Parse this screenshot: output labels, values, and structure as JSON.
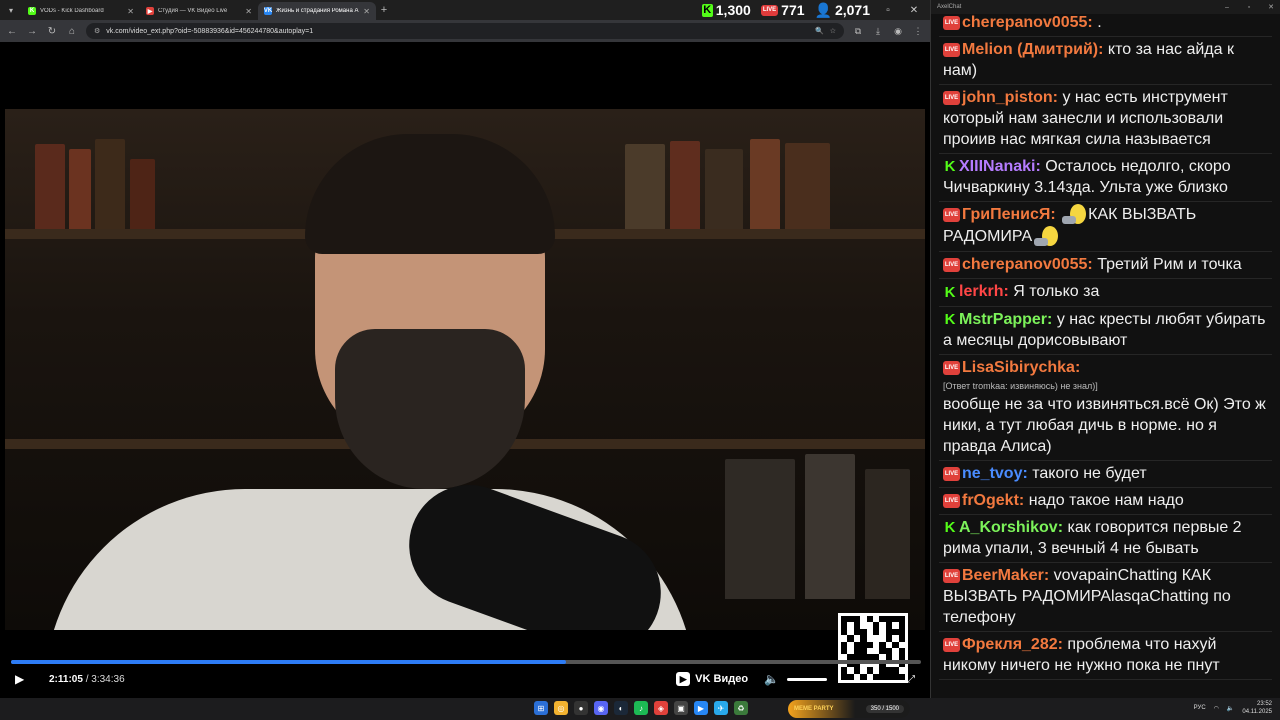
{
  "browser": {
    "tabs": [
      {
        "title": "VODs - Kick Dashboard",
        "fav_color": "#53fc18",
        "fav_letter": "K",
        "active": false
      },
      {
        "title": "Студия — VK Видео Live",
        "fav_color": "#e0413b",
        "fav_letter": "▶",
        "active": false
      },
      {
        "title": "Жизнь и страдания Романа А",
        "fav_color": "#2787f5",
        "fav_letter": "VK",
        "active": true
      }
    ],
    "url": "vk.com/video_ext.php?oid=-50883936&id=456244780&autoplay=1"
  },
  "stats": {
    "kick_count": "1,300",
    "live_count": "771",
    "viewers": "2,071",
    "live_badge": "LIVE"
  },
  "video": {
    "current_time": "2:11:05",
    "separator": "/",
    "duration": "3:34:36",
    "progress": 0.61,
    "brand": "VK Видео"
  },
  "chat": {
    "window_title": "AxelChat",
    "messages": [
      {
        "platform": "live",
        "user": "cherepanov0055:",
        "color": "#f2793f",
        "text": "."
      },
      {
        "platform": "live",
        "user": "Melion (Дмитрий):",
        "color": "#f2793f",
        "text": "кто за нас айда к нам)"
      },
      {
        "platform": "live",
        "user": "john_piston:",
        "color": "#f2793f",
        "text": "у нас есть инструмент который нам занесли и использовали проиив нас мягкая сила называется"
      },
      {
        "platform": "kick",
        "user": "XIIINanaki:",
        "color": "#b57cff",
        "text": "Осталось недолго, скоро Чичваркину 3.14зда. Ульта уже близко"
      },
      {
        "platform": "live",
        "user": "ГриПенисЯ:",
        "color": "#f2793f",
        "text_a": "КАК ВЫЗВАТЬ",
        "text_b": "РАДОМИРА",
        "emote": true
      },
      {
        "platform": "live",
        "user": "cherepanov0055:",
        "color": "#f2793f",
        "text": "Третий Рим и точка"
      },
      {
        "platform": "kick",
        "user": "lerkrh:",
        "color": "#ff4646",
        "text": "Я только за"
      },
      {
        "platform": "kick",
        "user": "MstrPapper:",
        "color": "#7cf25a",
        "text": "у нас кресты любят убирать а месяцы дорисовывают"
      },
      {
        "platform": "live",
        "user": "LisaSibirychka:",
        "color": "#f2793f",
        "reply": "[Ответ tromkaa: извиняюсь) не знал)]",
        "text": "вообще не за что извиняться.всё Ок) Это ж ники, а тут любая дичь в норме. но я правда Алиса)"
      },
      {
        "platform": "live",
        "user": "ne_tvoy:",
        "color": "#4a8cff",
        "text": "такого не будет"
      },
      {
        "platform": "live",
        "user": "frOgekt:",
        "color": "#f2793f",
        "text": "надо такое нам надо"
      },
      {
        "platform": "kick",
        "user": "A_Korshikov:",
        "color": "#7cf25a",
        "text": "как говорится первые 2 рима упали, 3 вечный 4 не бывать"
      },
      {
        "platform": "live",
        "user": "BeerMaker:",
        "color": "#f2793f",
        "text": "vovapainChatting КАК ВЫЗВАТЬ РАДОМИРАlasqaChatting по телефону"
      },
      {
        "platform": "live",
        "user": "Фрекля_282:",
        "color": "#f2793f",
        "text": "проблема что нахуй никому ничего не нужно пока не пнут"
      }
    ]
  },
  "taskbar": {
    "meme_name": "MEME PARTY",
    "meme_count": "350 / 1500",
    "lang": "РУС",
    "time": "23:52",
    "date": "04.11.2025"
  },
  "icons": {
    "kick": "kick-icon",
    "live": "vk-live-icon",
    "viewers": "viewers-icon",
    "play": "play-icon",
    "volume": "volume-icon",
    "fullscreen": "fullscreen-icon"
  }
}
